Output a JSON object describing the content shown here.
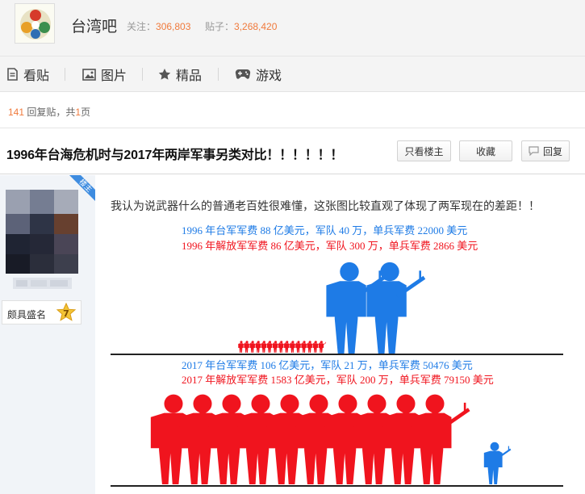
{
  "header": {
    "forum_name": "台湾吧",
    "follow_label": "关注：",
    "follow_count": "306,803",
    "post_label": "贴子：",
    "post_count": "3,268,420"
  },
  "tabs": [
    {
      "label": "看贴",
      "icon": "document-icon"
    },
    {
      "label": "图片",
      "icon": "image-icon"
    },
    {
      "label": "精品",
      "icon": "star-icon"
    },
    {
      "label": "游戏",
      "icon": "gamepad-icon"
    }
  ],
  "reply_info": {
    "count": "141",
    "text_a": " 回复贴，共",
    "pages": "1",
    "text_b": "页"
  },
  "post": {
    "title": "1996年台海危机时与2017年两岸军事另类对比！！！！！！",
    "btn_only_op": "只看楼主",
    "btn_collect": "收藏",
    "btn_reply": "回复",
    "op_tag": "楼主",
    "body_text": "我认为说武器什么的普通老百姓很难懂，这张图比较直观了体现了两军现在的差距！！"
  },
  "author": {
    "badge_label": "颇具盛名",
    "level": "7"
  },
  "colors": {
    "taiwan": "#1e7be6",
    "pla": "#f0141e",
    "accent": "#f07a3c"
  },
  "chart_data": {
    "type": "pictograph",
    "captions_1996": [
      "1996 年台军军费 88 亿美元，军队 40 万，单兵军费 22000 美元",
      "1996 年解放军军费 86 亿美元，军队 300 万，单兵军费 2866 美元"
    ],
    "captions_2017": [
      "2017 年台军军费 106 亿美元，军队 21 万，单兵军费 50476 美元",
      "2017 年解放军军费 1583 亿美元，军队 200 万，单兵军费 79150 美元"
    ],
    "panel_1996": {
      "small_red_soldiers": 15,
      "big_blue_soldiers": 2
    },
    "panel_2017": {
      "big_red_soldiers": 10,
      "small_blue_soldiers": 1
    }
  }
}
